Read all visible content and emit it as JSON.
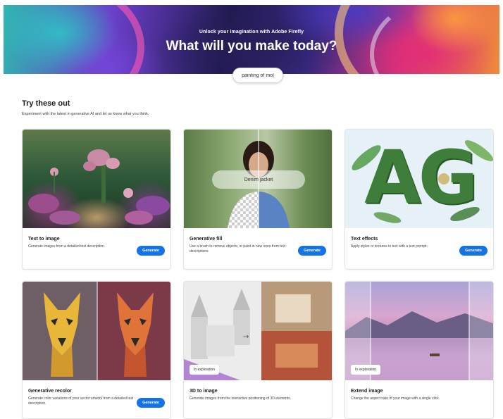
{
  "hero": {
    "subtitle": "Unlock your imagination with Adobe Firefly",
    "title": "What will you make today?",
    "search_value": "painting of mo|"
  },
  "section": {
    "title": "Try these out",
    "description": "Experiment with the latest in generative AI and let us know what you think."
  },
  "cards": [
    {
      "title": "Text to image",
      "description": "Generate images from a detailed text description.",
      "button": "Generate"
    },
    {
      "title": "Generative fill",
      "description": "Use a brush to remove objects, or paint in new ones from text descriptions",
      "button": "Generate",
      "overlay": "Denim jacket"
    },
    {
      "title": "Text effects",
      "description": "Apply styles or textures to text with a text prompt.",
      "button": "Generate",
      "sample_text": "AG"
    },
    {
      "title": "Generative recolor",
      "description": "Generate color variations of your vector artwork from a detailed text description.",
      "button": "Generate"
    },
    {
      "title": "3D to image",
      "description": "Generate images from the interactive positioning of 3D elements.",
      "badge": "In exploration",
      "arrow": "→"
    },
    {
      "title": "Extend image",
      "description": "Change the aspect ratio of your image with a single click.",
      "badge": "In exploration"
    }
  ],
  "colors": {
    "accent": "#1473e6"
  }
}
